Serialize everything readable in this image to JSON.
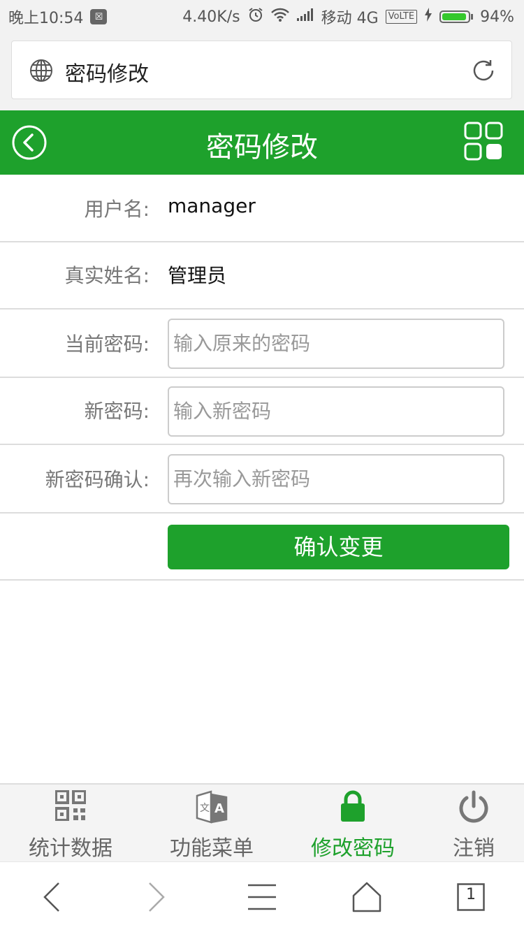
{
  "status_bar": {
    "time": "晚上10:54",
    "speed": "4.40K/s",
    "carrier": "移动 4G",
    "volte": "VoLTE",
    "battery": "94%"
  },
  "browser": {
    "page_title": "密码修改"
  },
  "header": {
    "title": "密码修改"
  },
  "form": {
    "username_label": "用户名:",
    "username_value": "manager",
    "realname_label": "真实姓名:",
    "realname_value": "管理员",
    "current_label": "当前密码:",
    "current_placeholder": "输入原来的密码",
    "new_label": "新密码:",
    "new_placeholder": "输入新密码",
    "confirm_label": "新密码确认:",
    "confirm_placeholder": "再次输入新密码",
    "submit_label": "确认变更"
  },
  "tabs": [
    {
      "label": "统计数据",
      "icon": "qrcode-icon"
    },
    {
      "label": "功能菜单",
      "icon": "translate-icon"
    },
    {
      "label": "修改密码",
      "icon": "lock-icon",
      "active": true
    },
    {
      "label": "注销",
      "icon": "power-icon"
    }
  ],
  "browser_nav": {
    "tab_count": "1"
  },
  "colors": {
    "brand_green": "#1ea12c"
  }
}
